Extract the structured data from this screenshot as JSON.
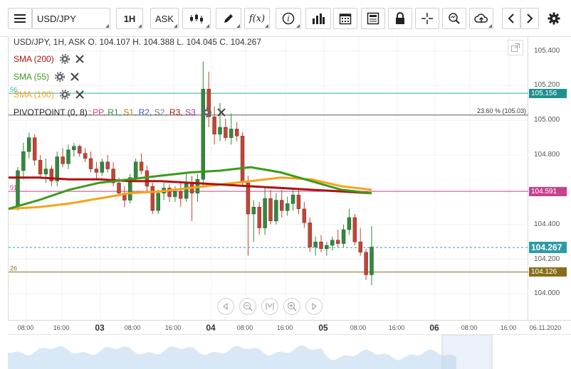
{
  "toolbar": {
    "symbol": "USD/JPY",
    "timeframe": "1H",
    "price_side": "ASK",
    "function_label": "f(x)"
  },
  "legend": {
    "ohlc_text": "USD/JPY, 1H, ASK   O. 104.107 H. 104.388 L. 104.045 C. 104.267",
    "sma200": "SMA (200)",
    "sma55": "SMA (55)",
    "sma100": "SMA (100)",
    "pivot": "PIVOTPOINT (0, 8)",
    "pivot_items": [
      "PP",
      "R1",
      "S1",
      "R2",
      "S2",
      "R3",
      "S3"
    ],
    "fib_label": "23.60 % (105.03)",
    "line_label_56": "56",
    "line_label_91": "91",
    "line_label_26": "26"
  },
  "colors": {
    "up": "#2e8b3b",
    "down": "#c8432f",
    "sma200": "#b01010",
    "sma55": "#3b9a1d",
    "sma100": "#f5a31a",
    "teal_line": "#2bb39a",
    "pink_line": "#c8428c",
    "olive_line": "#8a6d1a",
    "last_price": "#2e9aa8"
  },
  "price_axis": {
    "labels": [
      "105.400",
      "105.200",
      "105.000",
      "104.800",
      "104.400",
      "104.200",
      "104.000"
    ],
    "tags": [
      {
        "text": "105.156",
        "color": "#1f8f8f"
      },
      {
        "text": "104.591",
        "color": "#c8428c"
      },
      {
        "text": "104.267",
        "color": "#2e9aa8"
      },
      {
        "text": "104.126",
        "color": "#8a6d1a"
      }
    ]
  },
  "time_axis": {
    "labels": [
      "08:00",
      "16:00",
      "03",
      "08:00",
      "16:00",
      "04",
      "08:00",
      "16:00",
      "05",
      "08:00",
      "16:00",
      "06",
      "08:00",
      "16:00",
      "06.11.2020"
    ]
  },
  "chart_data": {
    "type": "candlestick",
    "title": "USD/JPY, 1H, ASK",
    "ohlc_last": {
      "open": 104.107,
      "high": 104.388,
      "low": 104.045,
      "close": 104.267
    },
    "ylim": [
      103.85,
      105.48
    ],
    "candles": [
      [
        104.51,
        104.73,
        104.48,
        104.71
      ],
      [
        104.71,
        104.87,
        104.66,
        104.82
      ],
      [
        104.82,
        104.93,
        104.78,
        104.9
      ],
      [
        104.9,
        104.92,
        104.74,
        104.77
      ],
      [
        104.77,
        104.8,
        104.67,
        104.69
      ],
      [
        104.69,
        104.78,
        104.64,
        104.72
      ],
      [
        104.72,
        104.74,
        104.62,
        104.65
      ],
      [
        104.65,
        104.82,
        104.62,
        104.79
      ],
      [
        104.79,
        104.84,
        104.73,
        104.75
      ],
      [
        104.75,
        104.86,
        104.72,
        104.83
      ],
      [
        104.83,
        104.87,
        104.79,
        104.85
      ],
      [
        104.85,
        104.86,
        104.79,
        104.81
      ],
      [
        104.81,
        104.84,
        104.76,
        104.78
      ],
      [
        104.78,
        104.82,
        104.7,
        104.72
      ],
      [
        104.72,
        104.76,
        104.66,
        104.7
      ],
      [
        104.7,
        104.78,
        104.68,
        104.76
      ],
      [
        104.76,
        104.8,
        104.7,
        104.72
      ],
      [
        104.72,
        104.76,
        104.62,
        104.64
      ],
      [
        104.64,
        104.67,
        104.56,
        104.58
      ],
      [
        104.58,
        104.62,
        104.5,
        104.54
      ],
      [
        104.54,
        104.69,
        104.52,
        104.67
      ],
      [
        104.67,
        104.78,
        104.65,
        104.76
      ],
      [
        104.76,
        104.81,
        104.69,
        104.71
      ],
      [
        104.71,
        104.74,
        104.59,
        104.62
      ],
      [
        104.62,
        104.64,
        104.46,
        104.48
      ],
      [
        104.48,
        104.6,
        104.46,
        104.58
      ],
      [
        104.58,
        104.64,
        104.54,
        104.61
      ],
      [
        104.61,
        104.63,
        104.53,
        104.56
      ],
      [
        104.56,
        104.62,
        104.53,
        104.59
      ],
      [
        104.59,
        104.65,
        104.5,
        104.55
      ],
      [
        104.55,
        104.7,
        104.53,
        104.64
      ],
      [
        104.64,
        104.68,
        104.42,
        104.58
      ],
      [
        104.58,
        104.69,
        104.53,
        104.66
      ],
      [
        104.66,
        105.34,
        104.62,
        105.18
      ],
      [
        105.18,
        105.28,
        104.96,
        105.02
      ],
      [
        105.02,
        105.08,
        104.86,
        104.92
      ],
      [
        104.92,
        105.1,
        104.88,
        104.96
      ],
      [
        104.96,
        105.01,
        104.88,
        104.9
      ],
      [
        104.9,
        105.04,
        104.86,
        104.95
      ],
      [
        104.95,
        104.99,
        104.88,
        104.91
      ],
      [
        104.91,
        104.93,
        104.62,
        104.64
      ],
      [
        104.64,
        104.68,
        104.22,
        104.46
      ],
      [
        104.46,
        104.54,
        104.3,
        104.5
      ],
      [
        104.5,
        104.53,
        104.34,
        104.38
      ],
      [
        104.38,
        104.62,
        104.34,
        104.55
      ],
      [
        104.55,
        104.6,
        104.4,
        104.42
      ],
      [
        104.42,
        104.58,
        104.4,
        104.54
      ],
      [
        104.54,
        104.6,
        104.44,
        104.48
      ],
      [
        104.48,
        104.56,
        104.45,
        104.52
      ],
      [
        104.52,
        104.6,
        104.48,
        104.57
      ],
      [
        104.57,
        104.6,
        104.46,
        104.49
      ],
      [
        104.49,
        104.53,
        104.38,
        104.41
      ],
      [
        104.41,
        104.44,
        104.24,
        104.27
      ],
      [
        104.27,
        104.33,
        104.22,
        104.3
      ],
      [
        104.3,
        104.34,
        104.24,
        104.26
      ],
      [
        104.26,
        104.3,
        104.22,
        104.28
      ],
      [
        104.28,
        104.33,
        104.25,
        104.31
      ],
      [
        104.31,
        104.37,
        104.27,
        104.29
      ],
      [
        104.29,
        104.4,
        104.27,
        104.37
      ],
      [
        104.37,
        104.49,
        104.34,
        104.44
      ],
      [
        104.44,
        104.46,
        104.28,
        104.3
      ],
      [
        104.3,
        104.38,
        104.22,
        104.24
      ],
      [
        104.24,
        104.26,
        104.08,
        104.11
      ],
      [
        104.11,
        104.39,
        104.05,
        104.27
      ]
    ],
    "sma200": [
      104.67,
      104.67,
      104.66,
      104.66,
      104.65,
      104.65,
      104.64,
      104.63,
      104.62,
      104.61,
      104.6,
      104.59,
      104.58
    ],
    "sma55": [
      104.49,
      104.54,
      104.6,
      104.64,
      104.66,
      104.68,
      104.7,
      104.71,
      104.73,
      104.7,
      104.65,
      104.6,
      104.58
    ],
    "sma100": [
      104.49,
      104.5,
      104.52,
      104.55,
      104.58,
      104.59,
      104.61,
      104.63,
      104.65,
      104.67,
      104.66,
      104.62,
      104.6
    ],
    "levels": {
      "teal": 105.156,
      "fib_23_6": 105.03,
      "pink": 104.591,
      "last": 104.267,
      "olive": 104.126
    }
  }
}
